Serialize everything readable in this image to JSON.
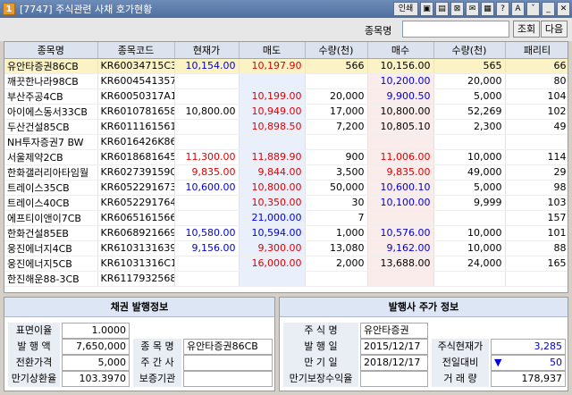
{
  "window": {
    "num": "1",
    "title": "[7747] 주식관련 사채 호가현황",
    "buttons": [
      "인쇄",
      "▣",
      "▤",
      "⊠",
      "✉",
      "▦",
      "?",
      "A",
      "ˇ",
      "_",
      "✕"
    ]
  },
  "search": {
    "label": "종목명",
    "value": "",
    "query_button": "조회",
    "next_button": "다음"
  },
  "table": {
    "headers": [
      "종목명",
      "종목코드",
      "현재가",
      "매도",
      "수량(천)",
      "매수",
      "수량(천)",
      "패리티"
    ],
    "rows": [
      {
        "name": "유안타증권86CB",
        "code": "KR60034715C3",
        "price": "10,154.00",
        "price_color": "blue",
        "ask": "10,197.90",
        "ask_color": "red",
        "ask_qty": "566",
        "bid": "10,156.00",
        "bid_color": "",
        "bid_qty": "565",
        "parity": "66",
        "selected": true
      },
      {
        "name": "깨끗한나라98CB",
        "code": "KR6004541357",
        "price": "",
        "price_color": "",
        "ask": "",
        "ask_color": "",
        "ask_qty": "",
        "bid": "10,200.00",
        "bid_color": "blue",
        "bid_qty": "20,000",
        "parity": "80"
      },
      {
        "name": "부산주공4CB",
        "code": "KR60050317A1",
        "price": "",
        "price_color": "",
        "ask": "10,199.00",
        "ask_color": "red",
        "ask_qty": "20,000",
        "bid": "9,900.50",
        "bid_color": "blue",
        "bid_qty": "5,000",
        "parity": "104"
      },
      {
        "name": "아이에스동서33CB",
        "code": "KR6010781658",
        "price": "10,800.00",
        "price_color": "",
        "ask": "10,949.00",
        "ask_color": "red",
        "ask_qty": "17,000",
        "bid": "10,800.00",
        "bid_color": "",
        "bid_qty": "52,269",
        "parity": "102"
      },
      {
        "name": "두산건설85CB",
        "code": "KR6011161561",
        "price": "",
        "price_color": "",
        "ask": "10,898.50",
        "ask_color": "red",
        "ask_qty": "7,200",
        "bid": "10,805.10",
        "bid_color": "",
        "bid_qty": "2,300",
        "parity": "49"
      },
      {
        "name": "NH투자증권7 BW",
        "code": "KR6016426K86",
        "price": "",
        "price_color": "",
        "ask": "",
        "ask_color": "",
        "ask_qty": "",
        "bid": "",
        "bid_color": "",
        "bid_qty": "",
        "parity": ""
      },
      {
        "name": "서울제약2CB",
        "code": "KR6018681645",
        "price": "11,300.00",
        "price_color": "red",
        "ask": "11,889.90",
        "ask_color": "red",
        "ask_qty": "900",
        "bid": "11,006.00",
        "bid_color": "red",
        "bid_qty": "10,000",
        "parity": "114"
      },
      {
        "name": "한화갤러리아타임월",
        "code": "KR6027391590",
        "price": "9,835.00",
        "price_color": "red",
        "ask": "9,844.00",
        "ask_color": "red",
        "ask_qty": "3,500",
        "bid": "9,835.00",
        "bid_color": "red",
        "bid_qty": "49,000",
        "parity": "29"
      },
      {
        "name": "트레이스35CB",
        "code": "KR6052291673",
        "price": "10,600.00",
        "price_color": "blue",
        "ask": "10,800.00",
        "ask_color": "red",
        "ask_qty": "50,000",
        "bid": "10,600.10",
        "bid_color": "blue",
        "bid_qty": "5,000",
        "parity": "98"
      },
      {
        "name": "트레이스40CB",
        "code": "KR6052291764",
        "price": "",
        "price_color": "",
        "ask": "10,350.00",
        "ask_color": "red",
        "ask_qty": "30",
        "bid": "10,100.00",
        "bid_color": "blue",
        "bid_qty": "9,999",
        "parity": "103"
      },
      {
        "name": "에프티이앤이7CB",
        "code": "KR6065161566",
        "price": "",
        "price_color": "",
        "ask": "21,000.00",
        "ask_color": "blue",
        "ask_qty": "7",
        "bid": "",
        "bid_color": "",
        "bid_qty": "",
        "parity": "157"
      },
      {
        "name": "한화건설85EB",
        "code": "KR6068921669",
        "price": "10,580.00",
        "price_color": "blue",
        "ask": "10,594.00",
        "ask_color": "blue",
        "ask_qty": "1,000",
        "bid": "10,576.00",
        "bid_color": "blue",
        "bid_qty": "10,000",
        "parity": "101"
      },
      {
        "name": "웅진에너지4CB",
        "code": "KR6103131639",
        "price": "9,156.00",
        "price_color": "blue",
        "ask": "9,300.00",
        "ask_color": "red",
        "ask_qty": "13,080",
        "bid": "9,162.00",
        "bid_color": "blue",
        "bid_qty": "10,000",
        "parity": "88"
      },
      {
        "name": "웅진에너지5CB",
        "code": "KR61031316C1",
        "price": "",
        "price_color": "",
        "ask": "16,000.00",
        "ask_color": "red",
        "ask_qty": "2,000",
        "bid": "13,688.00",
        "bid_color": "",
        "bid_qty": "24,000",
        "parity": "165"
      },
      {
        "name": "한진해운88-3CB",
        "code": "KR6117932568",
        "price": "",
        "price_color": "",
        "ask": "",
        "ask_color": "",
        "ask_qty": "",
        "bid": "",
        "bid_color": "",
        "bid_qty": "",
        "parity": ""
      }
    ]
  },
  "bond_panel": {
    "title": "채권 발행정보",
    "coupon_label": "표면이율",
    "coupon_value": "1.0000",
    "amount_label": "발 행 액",
    "amount_value": "7,650,000",
    "conv_label": "전환가격",
    "conv_value": "5,000",
    "ytm_label": "만기상환율",
    "ytm_value": "103.3970",
    "name_label": "종 목 명",
    "name_value": "유안타증권86CB",
    "manager_label": "주 간 사",
    "manager_value": "",
    "guarantor_label": "보증기관",
    "guarantor_value": ""
  },
  "stock_panel": {
    "title": "발행사 주가 정보",
    "stock_label": "주 식 명",
    "stock_value": "유안타증권",
    "issue_label": "발 행 일",
    "issue_value": "2015/12/17",
    "maturity_label": "만 기 일",
    "maturity_value": "2018/12/17",
    "guar_yield_label": "만기보장수익율",
    "guar_yield_value": "",
    "cur_price_label": "주식현재가",
    "cur_price_value": "3,285",
    "change_label": "전일대비",
    "change_arrow": "▼",
    "change_value": "50",
    "volume_label": "거 래 량",
    "volume_value": "178,937"
  }
}
